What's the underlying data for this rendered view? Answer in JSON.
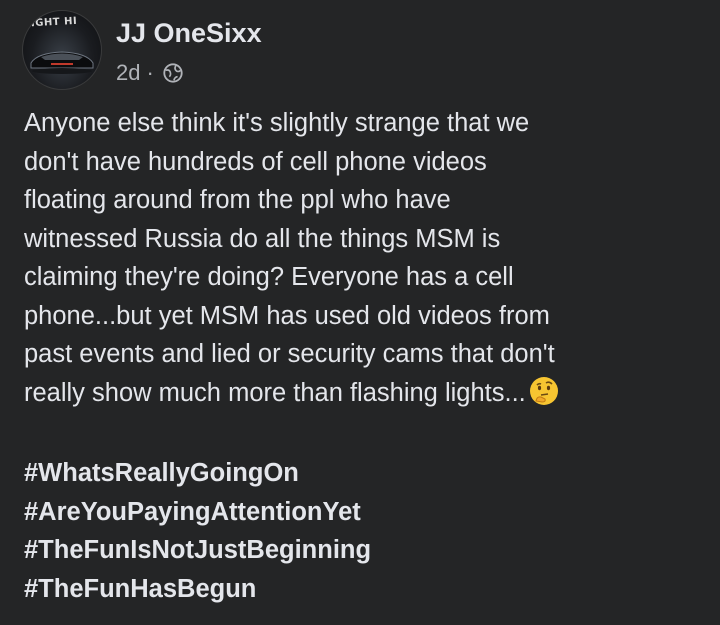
{
  "author": {
    "name": "JJ OneSixx",
    "avatar_text": "IGHT HI",
    "timestamp": "2d",
    "separator": "·",
    "privacy_icon": "globe-icon"
  },
  "post": {
    "lines": [
      "Anyone else think it's slightly strange that we",
      "don't have hundreds of cell phone videos",
      "floating around from the ppl who have",
      "witnessed Russia do all the things MSM is",
      "claiming they're doing? Everyone has a cell",
      "phone...but yet MSM has used old videos from",
      "past events and lied or security cams that don't",
      "really show much more than flashing lights..."
    ],
    "emoji": "thinking-face-icon",
    "hashtags": [
      "#WhatsReallyGoingOn",
      "#AreYouPayingAttentionYet",
      "#TheFunIsNotJustBeginning",
      "#TheFunHasBegun"
    ]
  },
  "colors": {
    "background": "#242526",
    "primary_text": "#e4e6eb",
    "secondary_text": "#b0b3b8"
  }
}
